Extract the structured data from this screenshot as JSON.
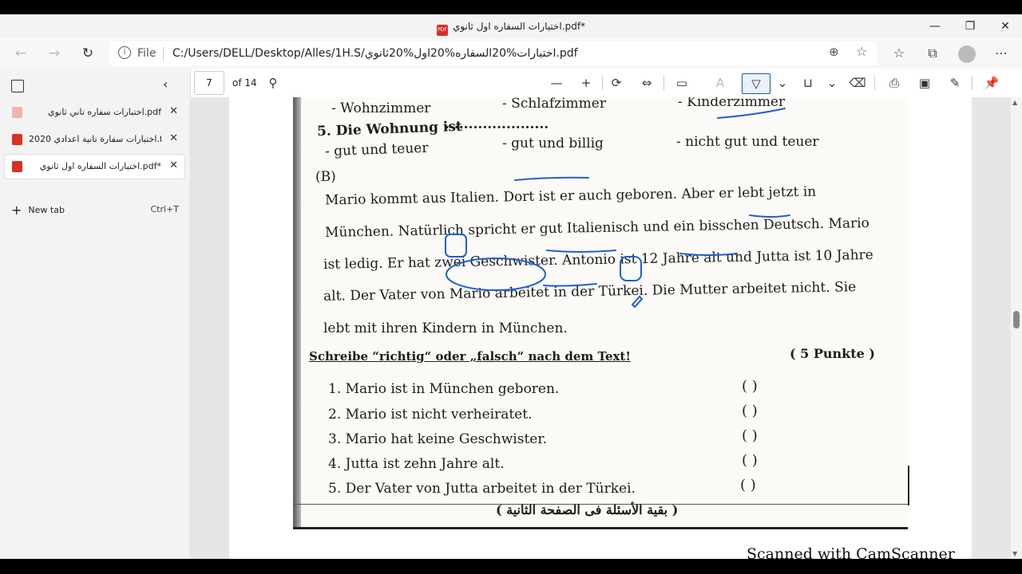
{
  "window": {
    "title": "اختبارات السفاره اول ثانوي.pdf*",
    "minimize": "—",
    "restore": "❐",
    "close": "✕"
  },
  "addressbar": {
    "file_label": "File",
    "url": "C:/Users/DELL/Desktop/Alles/1H.S/اختبارات%20السفاره%20اول%20ثانوي.pdf"
  },
  "sidebar": {
    "tabs": [
      {
        "label": "اختبارات سفاره تاني ثانوي.pdf",
        "active": false
      },
      {
        "label": "اختبارات سفارة تانية اعدادي 2020.f*",
        "active": false
      },
      {
        "label": "اختبارات السفاره اول ثانوي.pdf*",
        "active": true
      }
    ],
    "new_tab_label": "New tab",
    "new_tab_shortcut": "Ctrl+T"
  },
  "pdf_toolbar": {
    "page_number": "7",
    "page_of": "of 14"
  },
  "document": {
    "options": {
      "row4_a": "- Wohnzimmer",
      "row4_b": "- Schlafzimmer",
      "row4_c": "- Kinderzimmer",
      "q5_label": "5. Die Wohnung ist",
      "q5_dots": "......................",
      "row5_a": "- gut und teuer",
      "row5_b": "- gut und billig",
      "row5_c": "- nicht gut und teuer"
    },
    "section_b": "(B)",
    "paragraph": [
      "Mario kommt aus Italien. Dort ist er auch geboren. Aber er lebt jetzt in",
      "München. Natürlich spricht er gut Italienisch und ein bisschen Deutsch. Mario",
      "ist ledig. Er hat zwei Geschwister. Antonio ist 12 Jahre alt und Jutta ist 10 Jahre",
      "alt. Der Vater von Mario arbeitet in der Türkei. Die Mutter arbeitet nicht. Sie",
      "lebt mit ihren Kindern in München."
    ],
    "task_heading": "Schreibe “richtig“ oder „falsch“ nach dem Text!",
    "task_points": "( 5 Punkte )",
    "questions": [
      "1. Mario ist in München geboren.",
      "2. Mario ist nicht verheiratet.",
      "3. Mario hat keine Geschwister.",
      "4. Jutta ist zehn Jahre alt.",
      "5. Der Vater von Jutta arbeitet in der Türkei."
    ],
    "answer_paren": "(        )",
    "footer_arabic": "( بقية الأسئلة فى الصفحة الثانية )",
    "watermark": "Scanned with CamScanner"
  },
  "colors": {
    "annotation_ink": "#1f5fd6",
    "pdf_red": "#d93025",
    "active_tool": "#0b5cc6"
  }
}
